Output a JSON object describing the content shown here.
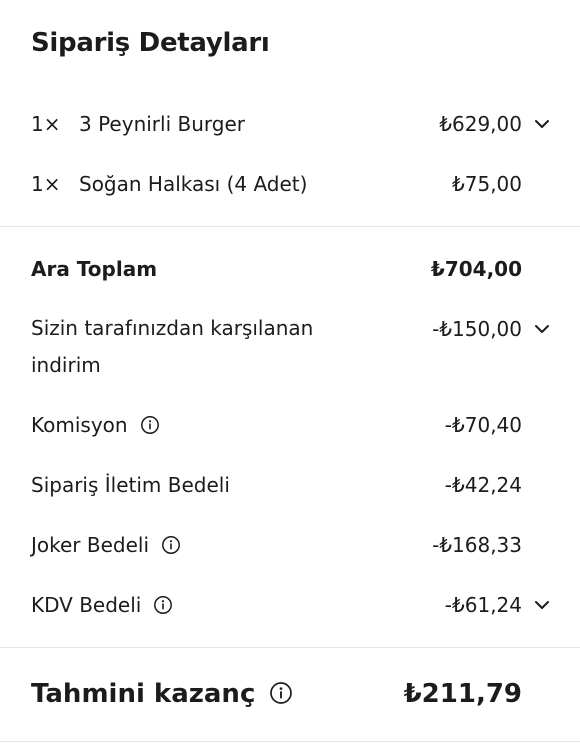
{
  "header": {
    "title": "Sipariş Detayları"
  },
  "items": [
    {
      "qty": "1×",
      "name": "3 Peynirli Burger",
      "price": "₺629,00"
    },
    {
      "qty": "1×",
      "name": "Soğan Halkası (4 Adet)",
      "price": "₺75,00"
    }
  ],
  "summary": {
    "subtotal_label": "Ara Toplam",
    "subtotal_value": "₺704,00",
    "discount_label": "Sizin tarafınızdan karşılanan indirim",
    "discount_value": "-₺150,00",
    "commission_label": "Komisyon",
    "commission_value": "-₺70,40",
    "delivery_fee_label": "Sipariş İletim Bedeli",
    "delivery_fee_value": "-₺42,24",
    "joker_label": "Joker Bedeli",
    "joker_value": "-₺168,33",
    "vat_label": "KDV Bedeli",
    "vat_value": "-₺61,24"
  },
  "total": {
    "label": "Tahmini kazanç",
    "value": "₺211,79"
  },
  "icons": {
    "chevron": "chevron-down-icon",
    "info": "info-icon"
  },
  "colors": {
    "text": "#1c1c1c",
    "divider": "#e4e4e4",
    "background": "#ffffff"
  }
}
